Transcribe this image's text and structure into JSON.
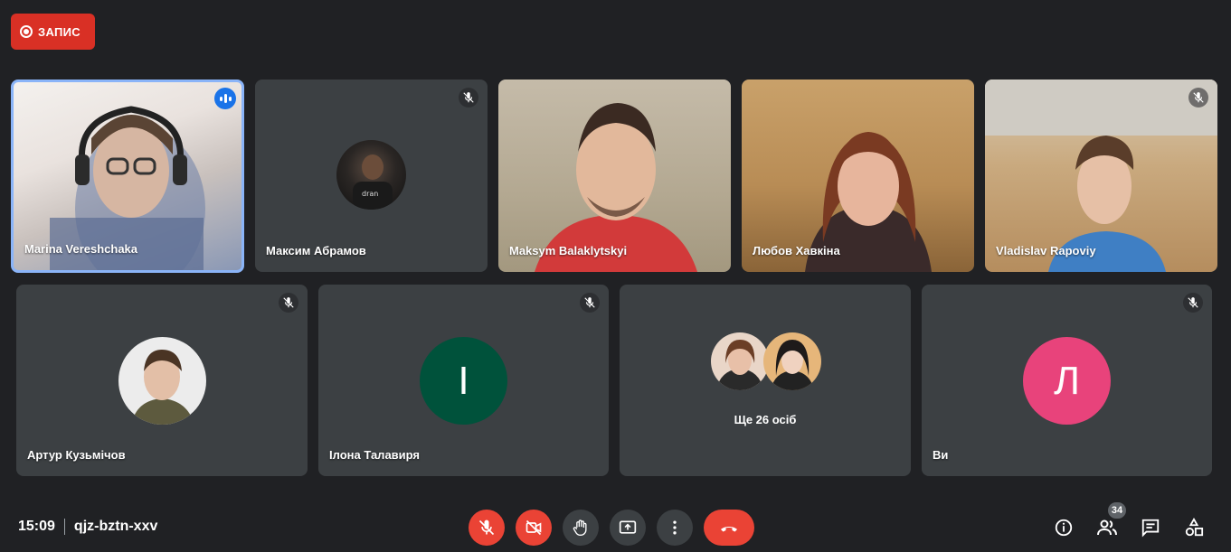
{
  "recording": {
    "label": "ЗАПИС"
  },
  "participants_row1": [
    {
      "name": "Marina Vereshchaka",
      "speaking": true
    },
    {
      "name": "Максим Абрамов",
      "muted": true
    },
    {
      "name": "Maksym Balaklytskyi"
    },
    {
      "name": "Любов Хавкіна"
    },
    {
      "name": "Vladislav Rapoviy",
      "muted": true
    }
  ],
  "participants_row2": [
    {
      "name": "Артур Кузьмічов",
      "muted": true
    },
    {
      "name": "Ілона Талавиря",
      "muted": true,
      "initial": "І",
      "color": "#00523b"
    },
    {
      "more_label": "Ще 26 осіб"
    },
    {
      "name": "Ви",
      "muted": true,
      "initial": "Л",
      "color": "#e8437b"
    }
  ],
  "meeting": {
    "time": "15:09",
    "code": "qjz-bztn-xxv"
  },
  "people_count": "34",
  "colors": {
    "accent": "#8ab4f8",
    "danger": "#ea4335",
    "tile": "#3c4043",
    "background": "#202124"
  },
  "controls": [
    "mic-off-icon",
    "camera-off-icon",
    "raise-hand-icon",
    "present-icon",
    "more-options-icon",
    "end-call-icon"
  ],
  "right_icons": [
    "info-icon",
    "people-icon",
    "chat-icon",
    "activities-icon"
  ]
}
